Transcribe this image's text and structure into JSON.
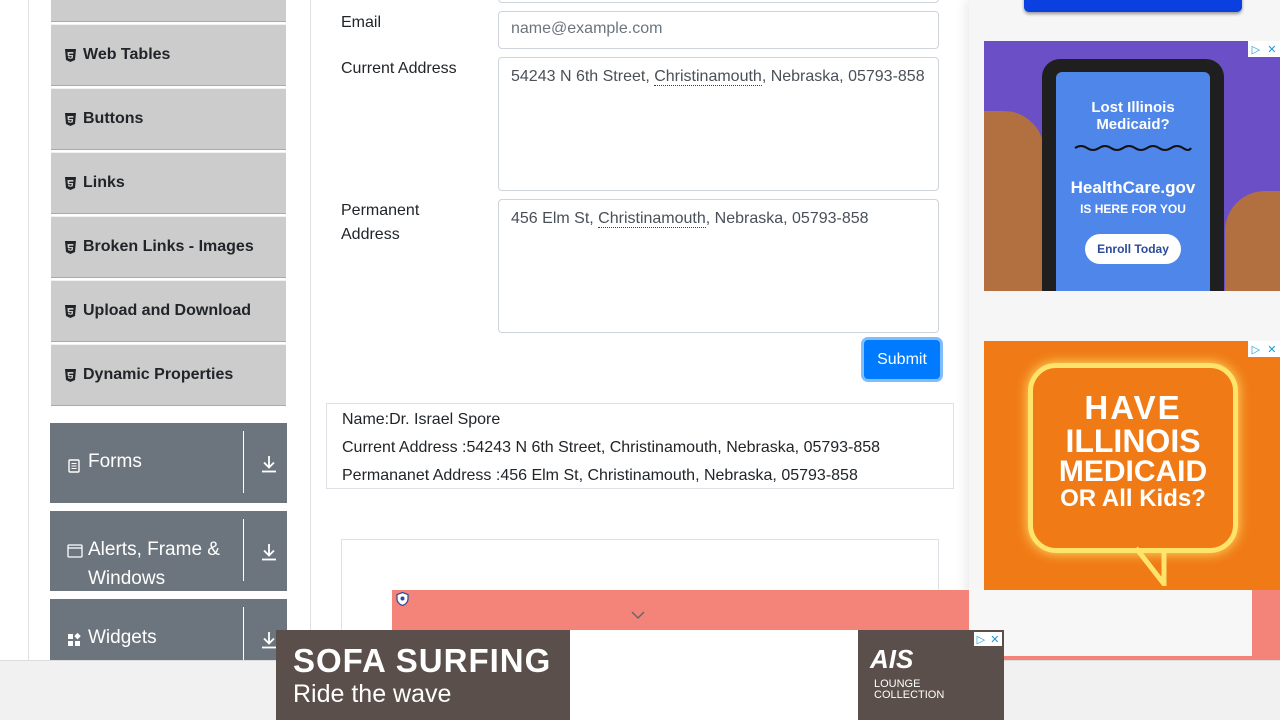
{
  "sidebar": {
    "menu_items": [
      {
        "label": ""
      },
      {
        "label": "Web Tables"
      },
      {
        "label": "Buttons"
      },
      {
        "label": "Links"
      },
      {
        "label": "Broken Links - Images"
      },
      {
        "label": "Upload and Download"
      },
      {
        "label": "Dynamic Properties"
      }
    ],
    "groups": [
      {
        "label": "Forms",
        "icon": "document-icon"
      },
      {
        "label": "Alerts, Frame & Windows",
        "icon": "window-icon"
      },
      {
        "label": "Widgets",
        "icon": "widgets-icon"
      }
    ]
  },
  "form": {
    "email_label": "Email",
    "email_placeholder": "name@example.com",
    "current_address_label": "Current Address",
    "current_address_value": {
      "part1": "54243 N 6th Street, ",
      "city": "Christinamouth",
      "part2": ", Nebraska, 05793-858"
    },
    "permanent_address_label": "Permanent Address",
    "permanent_address_value": {
      "part1": "456 Elm St, ",
      "city": "Christinamouth",
      "part2": ", Nebraska, 05793-858"
    },
    "submit_label": "Submit"
  },
  "output": {
    "name": "Name:Dr. Israel Spore",
    "current": "Current Address :54243 N 6th Street, Christinamouth, Nebraska, 05793-858",
    "permanent": "Permananet Address :456 Elm St, Christinamouth, Nebraska, 05793-858"
  },
  "ads": {
    "healthcare": {
      "headline": "Lost Illinois Medicaid?",
      "brand": "HealthCare.gov",
      "tagline": "IS HERE FOR YOU",
      "cta": "Enroll Today"
    },
    "medicaid": {
      "line1": "HAVE",
      "line2": "ILLINOIS",
      "line3": "MEDICAID",
      "line4": "OR All Kids?"
    },
    "banner": {
      "line1": "SOFA SURFING",
      "line2": "Ride the wave",
      "logo": "AIS",
      "logo_sub1": "LOUNGE",
      "logo_sub2": "COLLECTION"
    }
  },
  "colors": {
    "primary": "#007bff",
    "sidebar_item_bg": "#cccccc",
    "group_bg": "#6c757d"
  }
}
